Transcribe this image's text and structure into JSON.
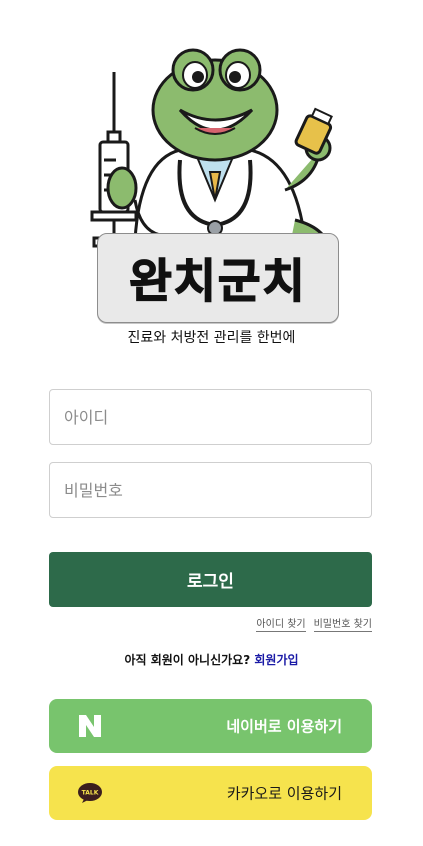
{
  "brand": {
    "logo_text": "완치군치",
    "tagline": "진료와 처방전 관리를 한번에"
  },
  "login_form": {
    "id_placeholder": "아이디",
    "password_placeholder": "비밀번호",
    "login_label": "로그인",
    "find_id_label": "아이디 찾기",
    "find_password_label": "비밀번호 찾기"
  },
  "signup": {
    "prompt": "아직 회원이 아니신가요?",
    "link_label": "회원가입"
  },
  "social": {
    "naver_label": "네이버로 이용하기",
    "naver_icon_letter": "N",
    "kakao_label": "카카오로 이용하기",
    "kakao_icon_text": "TALK"
  },
  "colors": {
    "primary": "#2d6a4a",
    "naver": "#78c46d",
    "kakao": "#f6e34d",
    "link": "#1a1aa6"
  }
}
